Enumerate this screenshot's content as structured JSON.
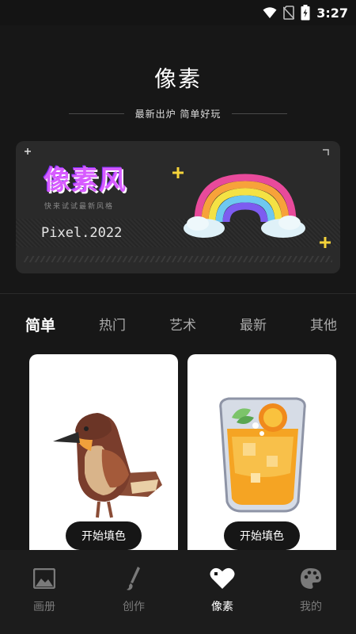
{
  "status": {
    "time": "3:27"
  },
  "header": {
    "title": "像素",
    "subtitle": "最新出炉 简单好玩"
  },
  "banner": {
    "logo": "像素风",
    "tagline": "快来试试最新风格",
    "year": "Pixel.2022"
  },
  "tabs": [
    {
      "label": "简单",
      "active": true
    },
    {
      "label": "热门",
      "active": false
    },
    {
      "label": "艺术",
      "active": false
    },
    {
      "label": "最新",
      "active": false
    },
    {
      "label": "其他",
      "active": false
    }
  ],
  "cards": [
    {
      "subject": "bird-icon",
      "button": "开始填色"
    },
    {
      "subject": "drink-icon",
      "button": "开始填色"
    }
  ],
  "navbar": [
    {
      "label": "画册",
      "icon": "image-icon",
      "active": false
    },
    {
      "label": "创作",
      "icon": "brush-icon",
      "active": false
    },
    {
      "label": "像素",
      "icon": "heart-icon",
      "active": true
    },
    {
      "label": "我的",
      "icon": "palette-icon",
      "active": false
    }
  ],
  "colors": {
    "background": "#171717",
    "card": "#ffffff",
    "active_text": "#ffffff",
    "inactive_text": "#7a7a7a"
  }
}
